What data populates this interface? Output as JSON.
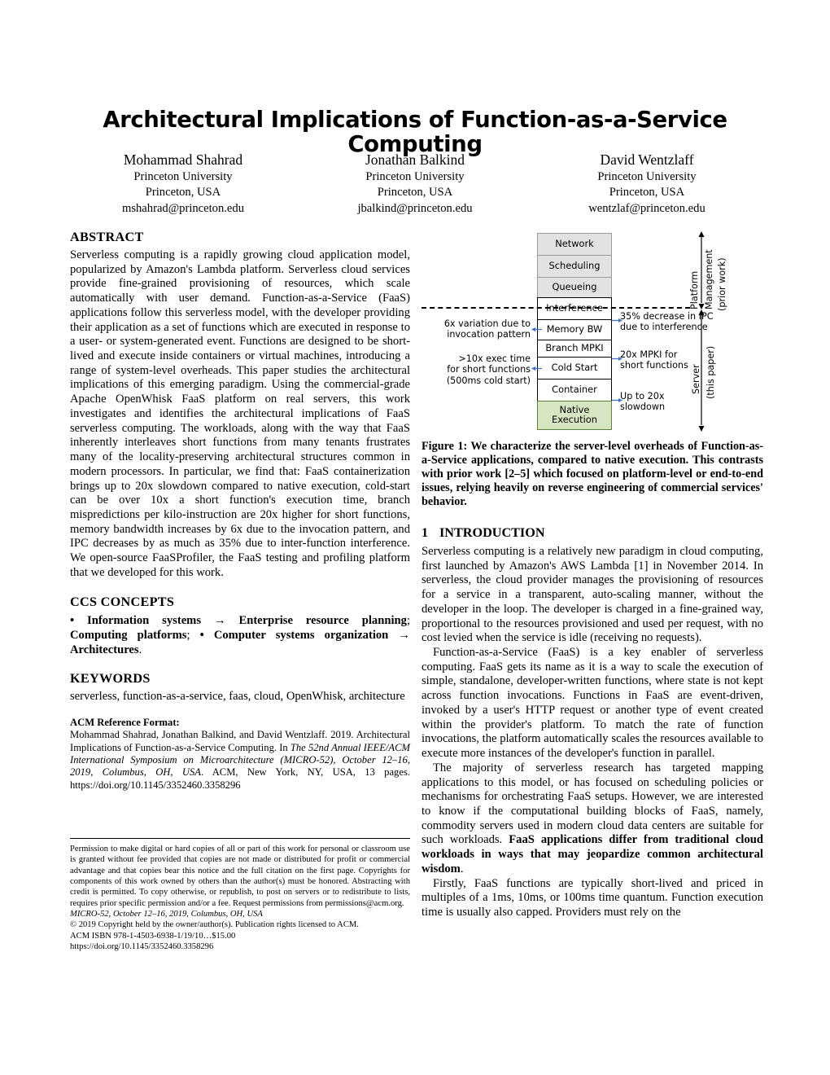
{
  "paper": {
    "title": "Architectural Implications of Function-as-a-Service Computing",
    "authors": [
      {
        "name": "Mohammad Shahrad",
        "affiliation": "Princeton University",
        "city": "Princeton, USA",
        "email": "mshahrad@princeton.edu"
      },
      {
        "name": "Jonathan Balkind",
        "affiliation": "Princeton University",
        "city": "Princeton, USA",
        "email": "jbalkind@princeton.edu"
      },
      {
        "name": "David Wentzlaff",
        "affiliation": "Princeton University",
        "city": "Princeton, USA",
        "email": "wentzlaf@princeton.edu"
      }
    ]
  },
  "abstract": {
    "heading": "ABSTRACT",
    "text": "Serverless computing is a rapidly growing cloud application model, popularized by Amazon's Lambda platform. Serverless cloud services provide fine-grained provisioning of resources, which scale automatically with user demand. Function-as-a-Service (FaaS) applications follow this serverless model, with the developer providing their application as a set of functions which are executed in response to a user- or system-generated event. Functions are designed to be short-lived and execute inside containers or virtual machines, introducing a range of system-level overheads. This paper studies the architectural implications of this emerging paradigm. Using the commercial-grade Apache OpenWhisk FaaS platform on real servers, this work investigates and identifies the architectural implications of FaaS serverless computing. The workloads, along with the way that FaaS inherently interleaves short functions from many tenants frustrates many of the locality-preserving architectural structures common in modern processors. In particular, we find that: FaaS containerization brings up to 20x slowdown compared to native execution, cold-start can be over 10x a short function's execution time, branch mispredictions per kilo-instruction are 20x higher for short functions, memory bandwidth increases by 6x due to the invocation pattern, and IPC decreases by as much as 35% due to inter-function interference. We open-source FaaSProfiler, the FaaS testing and profiling platform that we developed for this work."
  },
  "ccs": {
    "heading": "CCS CONCEPTS",
    "text_bold_1": "• Information systems → Enterprise resource planning",
    "sep_1": ";",
    "text_bold_2": " Computing platforms",
    "sep_2": ";",
    "text_bold_3": " • Computer systems organization → Architectures",
    "period": "."
  },
  "keywords": {
    "heading": "KEYWORDS",
    "text": "serverless, function-as-a-service, faas, cloud, OpenWhisk, architecture"
  },
  "reference": {
    "heading": "ACM Reference Format:",
    "line_1": "Mohammad Shahrad, Jonathan Balkind, and David Wentzlaff. 2019. Architectural Implications of Function-as-a-Service Computing. In ",
    "italic_1": "The 52nd Annual IEEE/ACM International Symposium on Microarchitecture (MICRO-52), October 12–16, 2019, Columbus, OH, USA",
    "line_2": ". ACM, New York, NY, USA, 13 pages. https://doi.org/10.1145/3352460.3358296"
  },
  "copyright": {
    "permission": "Permission to make digital or hard copies of all or part of this work for personal or classroom use is granted without fee provided that copies are not made or distributed for profit or commercial advantage and that copies bear this notice and the full citation on the first page. Copyrights for components of this work owned by others than the author(s) must be honored. Abstracting with credit is permitted. To copy otherwise, or republish, to post on servers or to redistribute to lists, requires prior specific permission and/or a fee. Request permissions from permissions@acm.org.",
    "venue": "MICRO-52, October 12–16, 2019, Columbus, OH, USA",
    "holder": "© 2019 Copyright held by the owner/author(s). Publication rights licensed to ACM.",
    "isbn": "ACM ISBN 978-1-4503-6938-1/19/10…$15.00",
    "doi": "https://doi.org/10.1145/3352460.3358296"
  },
  "figure": {
    "caption_label": "Figure 1:",
    "caption_text": " We characterize the server-level overheads of Function-as-a-Service applications, compared to native execution. This contrasts with prior work [2–5] which focused on platform-level or end-to-end issues, relying heavily on reverse engineering of commercial services' behavior.",
    "stack": [
      {
        "label": "Network",
        "style": "gray"
      },
      {
        "label": "Scheduling",
        "style": "gray"
      },
      {
        "label": "Queueing",
        "style": "gray"
      },
      {
        "label": "Interference",
        "style": "white"
      },
      {
        "label": "Memory BW",
        "style": "white"
      },
      {
        "label": "Branch MPKI",
        "style": "white"
      },
      {
        "label": "Cold Start",
        "style": "white"
      },
      {
        "label": "Container",
        "style": "white"
      },
      {
        "label": "Native Execution",
        "style": "green"
      }
    ],
    "annotations_left": [
      {
        "line_1": "6x variation due to",
        "line_2": "invocation pattern",
        "line_3": ""
      },
      {
        "line_1": ">10x exec time",
        "line_2": "for short functions",
        "line_3": "(500ms cold start)"
      }
    ],
    "annotations_right": [
      {
        "line_1": "35% decrease in IPC",
        "line_2": "due to interference"
      },
      {
        "line_1": "20x MPKI for",
        "line_2": "short functions"
      },
      {
        "line_1": "Up to 20x",
        "line_2": "slowdown"
      }
    ],
    "axis_labels": {
      "platform_line_1": "Platform",
      "platform_line_2": "Management",
      "platform_line_3": "(prior work)",
      "server_line_1": "Server",
      "server_line_2": "(this paper)"
    },
    "colors": {
      "gray_box": "#e2e2e2",
      "green_box": "#d6e6c2",
      "arrow": "#4472c4"
    }
  },
  "introduction": {
    "number": "1",
    "heading": "INTRODUCTION",
    "p1": "Serverless computing is a relatively new paradigm in cloud computing, first launched by Amazon's AWS Lambda [1] in November 2014. In serverless, the cloud provider manages the provisioning of resources for a service in a transparent, auto-scaling manner, without the developer in the loop. The developer is charged in a fine-grained way, proportional to the resources provisioned and used per request, with no cost levied when the service is idle (receiving no requests).",
    "p2": "Function-as-a-Service (FaaS) is a key enabler of serverless computing. FaaS gets its name as it is a way to scale the execution of simple, standalone, developer-written functions, where state is not kept across function invocations. Functions in FaaS are event-driven, invoked by a user's HTTP request or another type of event created within the provider's platform. To match the rate of function invocations, the platform automatically scales the resources available to execute more instances of the developer's function in parallel.",
    "p3_a": "The majority of serverless research has targeted mapping applications to this model, or has focused on scheduling policies or mechanisms for orchestrating FaaS setups. However, we are interested to know if the computational building blocks of FaaS, namely, commodity servers used in modern cloud data centers are suitable for such workloads. ",
    "p3_bold": "FaaS applications differ from traditional cloud workloads in ways that may jeopardize common architectural wisdom",
    "p3_c": ".",
    "p4": "Firstly, FaaS functions are typically short-lived and priced in multiples of a 1ms, 10ms, or 100ms time quantum. Function execution time is usually also capped. Providers must rely on the"
  }
}
